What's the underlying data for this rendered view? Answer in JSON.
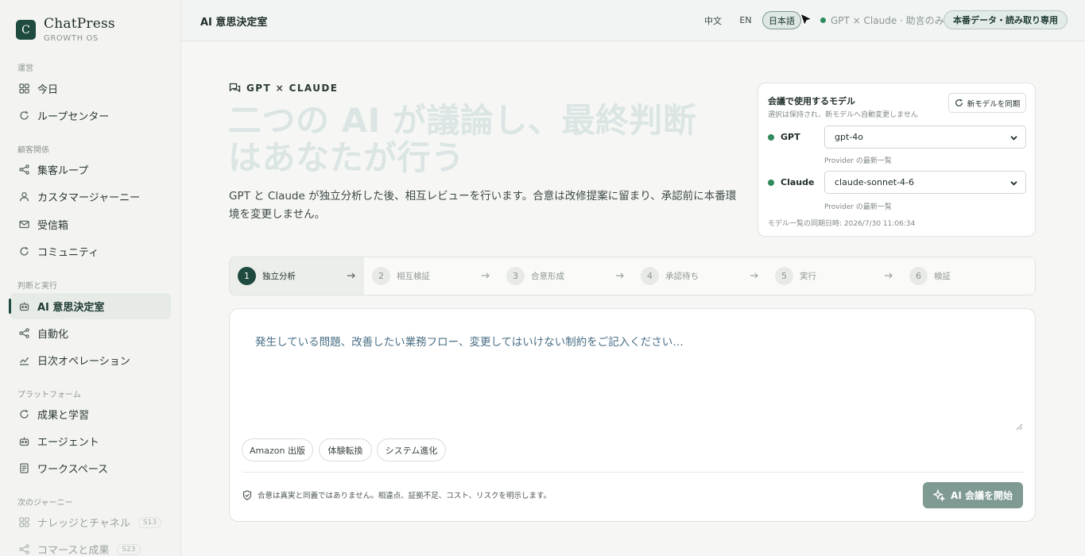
{
  "brand": {
    "logo_letter": "C",
    "name": "ChatPress",
    "subtitle": "GROWTH OS"
  },
  "sidebar": {
    "sections": [
      {
        "label": "運営",
        "items": [
          {
            "label": "今日",
            "icon": "grid-icon"
          },
          {
            "label": "ループセンター",
            "icon": "refresh-icon"
          }
        ]
      },
      {
        "label": "顧客関係",
        "items": [
          {
            "label": "集客ループ",
            "icon": "share-icon"
          },
          {
            "label": "カスタマージャーニー",
            "icon": "user-icon"
          },
          {
            "label": "受信箱",
            "icon": "mail-icon"
          },
          {
            "label": "コミュニティ",
            "icon": "refresh-icon"
          }
        ]
      },
      {
        "label": "判断と実行",
        "items": [
          {
            "label": "AI 意思決定室",
            "icon": "bot-icon",
            "active": true
          },
          {
            "label": "自動化",
            "icon": "share-icon"
          },
          {
            "label": "日次オペレーション",
            "icon": "chart-icon"
          }
        ]
      },
      {
        "label": "プラットフォーム",
        "items": [
          {
            "label": "成果と学習",
            "icon": "refresh-icon"
          },
          {
            "label": "エージェント",
            "icon": "bot-icon"
          },
          {
            "label": "ワークスペース",
            "icon": "document-icon"
          }
        ]
      },
      {
        "label": "次のジャーニー",
        "items": [
          {
            "label": "ナレッジとチャネル",
            "icon": "grid-icon",
            "badge": "S13"
          },
          {
            "label": "コマースと成果",
            "icon": "share-icon",
            "badge": "S23"
          }
        ]
      }
    ]
  },
  "header": {
    "title": "AI 意思決定室",
    "languages": [
      "中文",
      "EN",
      "日本語"
    ],
    "active_language": "日本語",
    "status": "GPT × Claude · 助言のみ",
    "prod_badge": "本番データ・読み取り専用"
  },
  "hero": {
    "eyebrow": "GPT × CLAUDE",
    "title": "二つの AI が議論し、最終判断はあなたが行う",
    "lead": "GPT と Claude が独立分析した後、相互レビューを行います。合意は改修提案に留まり、承認前に本番環境を変更しません。"
  },
  "model_card": {
    "title": "会議で使用するモデル",
    "subtitle": "選択は保持され、新モデルへ自動変更しません",
    "sync_button": "新モデルを同期",
    "models": [
      {
        "label": "GPT",
        "value": "gpt-4o",
        "hint": "Provider の最新一覧"
      },
      {
        "label": "Claude",
        "value": "claude-sonnet-4-6",
        "hint": "Provider の最新一覧"
      }
    ],
    "synced_at": "モデル一覧の同期日時: 2026/7/30 11:06:34"
  },
  "stepper": {
    "active_step": 1,
    "steps": [
      {
        "num": "1",
        "label": "独立分析"
      },
      {
        "num": "2",
        "label": "相互検証"
      },
      {
        "num": "3",
        "label": "合意形成"
      },
      {
        "num": "4",
        "label": "承認待ち"
      },
      {
        "num": "5",
        "label": "実行"
      },
      {
        "num": "6",
        "label": "検証"
      }
    ]
  },
  "compose": {
    "placeholder": "発生している問題、改善したい業務フロー、変更してはいけない制約をご記入ください…",
    "chips": [
      "Amazon 出版",
      "体験転換",
      "システム進化"
    ],
    "disclaimer": "合意は真実と同義ではありません。相違点、証拠不足、コスト、リスクを明示します。",
    "start_button": "AI 会議を開始"
  },
  "colors": {
    "accent": "#1e4a3f",
    "status_dot": "#2f8a5d",
    "start_button": "#7f9993"
  }
}
